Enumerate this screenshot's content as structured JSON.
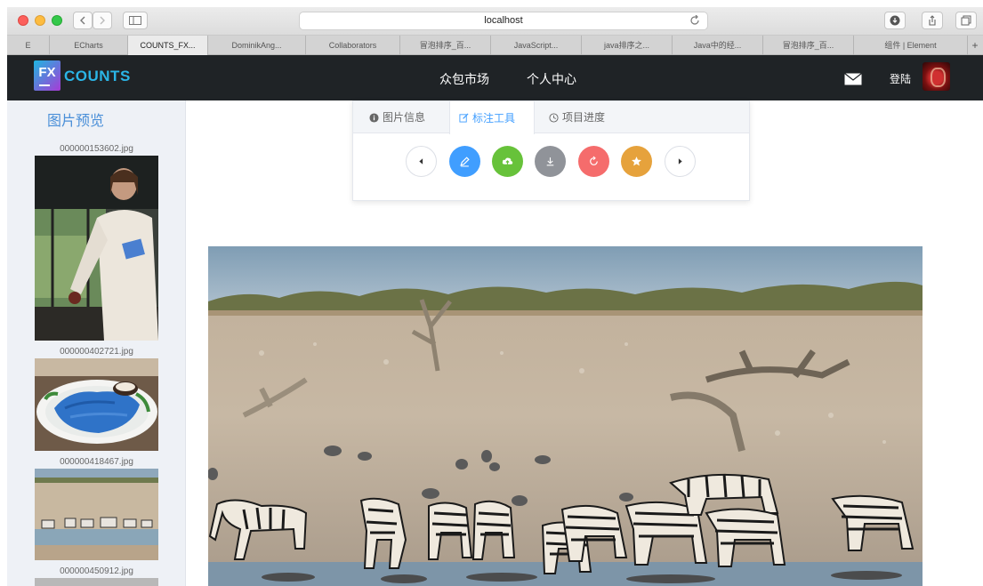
{
  "browser": {
    "url": "localhost",
    "tabs": [
      {
        "label": "E"
      },
      {
        "label": "ECharts"
      },
      {
        "label": "COUNTS_FX..."
      },
      {
        "label": "DominikAng..."
      },
      {
        "label": "Collaborators"
      },
      {
        "label": "冒泡排序_百..."
      },
      {
        "label": "JavaScript..."
      },
      {
        "label": "java排序之..."
      },
      {
        "label": "Java中的经..."
      },
      {
        "label": "冒泡排序_百..."
      },
      {
        "label": "组件 | Element"
      }
    ],
    "add_tab": "+"
  },
  "header": {
    "logo_mark": "FX",
    "logo_text": "COUNTS",
    "nav": [
      "众包市场",
      "个人中心"
    ],
    "login": "登陆"
  },
  "sidebar": {
    "title": "图片预览",
    "images": [
      {
        "name": "000000153602.jpg"
      },
      {
        "name": "000000402721.jpg"
      },
      {
        "name": "000000418467.jpg"
      },
      {
        "name": "000000450912.jpg"
      }
    ]
  },
  "panel": {
    "tabs": [
      {
        "label": "图片信息",
        "icon": "info-circle-icon"
      },
      {
        "label": "标注工具",
        "icon": "edit-icon"
      },
      {
        "label": "项目进度",
        "icon": "clock-icon"
      }
    ],
    "active_tab": 1,
    "tools": [
      {
        "name": "prev-button",
        "icon": "caret-left-icon",
        "color": "#ffffff"
      },
      {
        "name": "edit-button",
        "icon": "pencil-icon",
        "color": "#409eff"
      },
      {
        "name": "upload-button",
        "icon": "cloud-upload-icon",
        "color": "#67c23a"
      },
      {
        "name": "download-button",
        "icon": "download-icon",
        "color": "#909399"
      },
      {
        "name": "refresh-button",
        "icon": "refresh-icon",
        "color": "#f56c6c"
      },
      {
        "name": "star-button",
        "icon": "star-icon",
        "color": "#e6a23c"
      },
      {
        "name": "next-button",
        "icon": "caret-right-icon",
        "color": "#ffffff"
      }
    ]
  },
  "colors": {
    "header_bg": "#1f2326",
    "sidebar_bg": "#eef1f6",
    "accent": "#409eff",
    "sidebar_title": "#4a8fd8"
  }
}
